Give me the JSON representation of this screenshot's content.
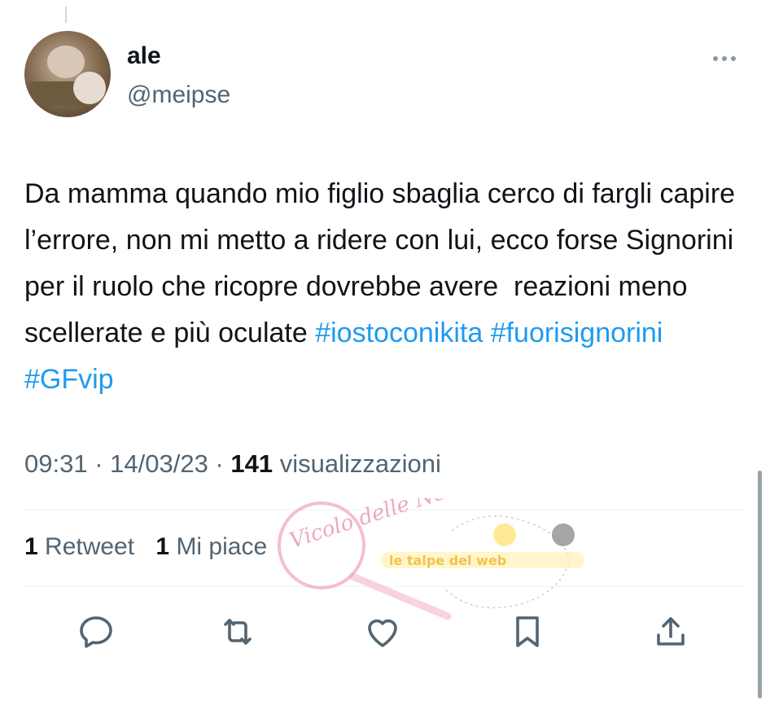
{
  "user": {
    "display_name": "ale",
    "handle": "@meipse"
  },
  "tweet": {
    "text": "Da mamma quando mio figlio sbaglia cerco di fargli capire l’errore, non mi metto a ridere con lui, ecco forse Signorini per il ruolo che ricopre dovrebbe avere  reazioni meno  scellerate e più oculate ",
    "hashtags": [
      "#iostoconikita",
      "#fuorisignorini",
      "#GFvip"
    ]
  },
  "meta": {
    "time": "09:31",
    "sep1": " · ",
    "date": "14/03/23",
    "sep2": " · ",
    "views_count": "141",
    "views_label": " visualizzazioni"
  },
  "stats": {
    "retweets_count": "1",
    "retweets_label": " Retweet",
    "likes_count": "1",
    "likes_label": " Mi piace"
  },
  "watermark": {
    "text1": "Vicolo delle News",
    "text2": "le talpe del web"
  },
  "icons": {
    "reply": "reply-icon",
    "retweet": "retweet-icon",
    "like": "like-icon",
    "bookmark": "bookmark-icon",
    "share": "share-icon",
    "more": "more-icon"
  },
  "colors": {
    "hashtag": "#1d9bf0",
    "secondary_text": "#536471",
    "icon": "#536471"
  }
}
